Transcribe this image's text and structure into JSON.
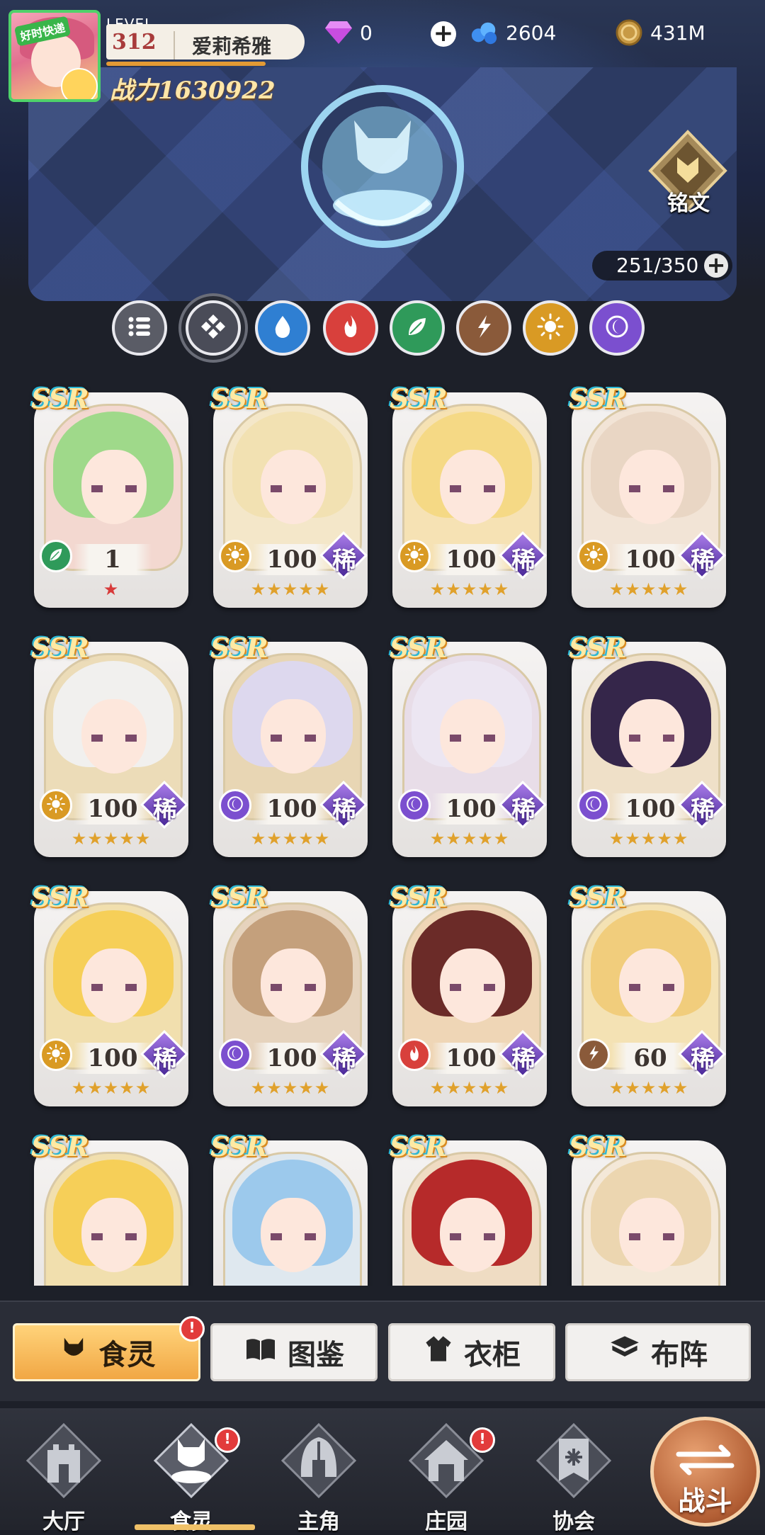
{
  "player": {
    "avatar_badge": "好时快递",
    "level_label": "LEVEL",
    "level": "312",
    "name": "爱莉希雅",
    "power": "战力1630922"
  },
  "resources": {
    "diamond": "0",
    "crystal": "2604",
    "coin": "431M"
  },
  "rune_label": "铭文",
  "capacity": "251/350",
  "filters": [
    {
      "name": "list",
      "color": "#5a5c66",
      "active": false
    },
    {
      "name": "all",
      "color": "#4a4c58",
      "active": true
    },
    {
      "name": "water",
      "color": "#2f7fd2",
      "active": false
    },
    {
      "name": "fire",
      "color": "#d8403c",
      "active": false
    },
    {
      "name": "leaf",
      "color": "#2f9a5a",
      "active": false
    },
    {
      "name": "earth",
      "color": "#8a5a3a",
      "active": false
    },
    {
      "name": "sun",
      "color": "#d99a24",
      "active": false
    },
    {
      "name": "moon",
      "color": "#7b4fcf",
      "active": false
    }
  ],
  "cards": [
    {
      "rarity": "SSR",
      "level": "1",
      "element": "leaf",
      "rare_tag": "",
      "stars": "★",
      "star_color": "red",
      "bg": "#f3d8d0",
      "hair": "#9fd98a"
    },
    {
      "rarity": "SSR",
      "level": "100",
      "element": "sun",
      "rare_tag": "稀",
      "stars": "★★★★★",
      "star_color": "gold",
      "bg": "#f4e7c9",
      "hair": "#f2e1b2"
    },
    {
      "rarity": "SSR",
      "level": "100",
      "element": "sun",
      "rare_tag": "稀",
      "stars": "★★★★★",
      "star_color": "gold",
      "bg": "#f6e2b4",
      "hair": "#f5d985"
    },
    {
      "rarity": "SSR",
      "level": "100",
      "element": "sun",
      "rare_tag": "稀",
      "stars": "★★★★★",
      "star_color": "gold",
      "bg": "#f2e4d6",
      "hair": "#e9d6c4"
    },
    {
      "rarity": "SSR",
      "level": "100",
      "element": "sun",
      "rare_tag": "稀",
      "stars": "★★★★★",
      "star_color": "gold",
      "bg": "#ecdcb8",
      "hair": "#f1f0ee"
    },
    {
      "rarity": "SSR",
      "level": "100",
      "element": "moon",
      "rare_tag": "稀",
      "stars": "★★★★★",
      "star_color": "gold",
      "bg": "#e8d6b4",
      "hair": "#ddd8ee"
    },
    {
      "rarity": "SSR",
      "level": "100",
      "element": "moon",
      "rare_tag": "稀",
      "stars": "★★★★★",
      "star_color": "gold",
      "bg": "#e8dde8",
      "hair": "#ece6f2"
    },
    {
      "rarity": "SSR",
      "level": "100",
      "element": "moon",
      "rare_tag": "稀",
      "stars": "★★★★★",
      "star_color": "gold",
      "bg": "#efe0c8",
      "hair": "#35264a"
    },
    {
      "rarity": "SSR",
      "level": "100",
      "element": "sun",
      "rare_tag": "稀",
      "stars": "★★★★★",
      "star_color": "gold",
      "bg": "#f1dfae",
      "hair": "#f6cf58"
    },
    {
      "rarity": "SSR",
      "level": "100",
      "element": "moon",
      "rare_tag": "稀",
      "stars": "★★★★★",
      "star_color": "gold",
      "bg": "#e6d3bd",
      "hair": "#c4a07c"
    },
    {
      "rarity": "SSR",
      "level": "100",
      "element": "fire",
      "rare_tag": "稀",
      "stars": "★★★★★",
      "star_color": "gold",
      "bg": "#efd6b6",
      "hair": "#6b2b28"
    },
    {
      "rarity": "SSR",
      "level": "60",
      "element": "earth",
      "rare_tag": "稀",
      "stars": "★★★★★",
      "star_color": "gold",
      "bg": "#f4e2b4",
      "hair": "#f1cd7c"
    },
    {
      "rarity": "SSR",
      "level": "",
      "element": "",
      "rare_tag": "",
      "stars": "",
      "star_color": "gold",
      "bg": "#f1dfae",
      "hair": "#f6cf58"
    },
    {
      "rarity": "SSR",
      "level": "",
      "element": "",
      "rare_tag": "",
      "stars": "",
      "star_color": "gold",
      "bg": "#dfe8ef",
      "hair": "#9cc9ec"
    },
    {
      "rarity": "SSR",
      "level": "",
      "element": "",
      "rare_tag": "",
      "stars": "",
      "star_color": "gold",
      "bg": "#efdcc3",
      "hair": "#b62a2a"
    },
    {
      "rarity": "SSR",
      "level": "",
      "element": "",
      "rare_tag": "",
      "stars": "",
      "star_color": "gold",
      "bg": "#f4e8d8",
      "hair": "#ecd6b0"
    }
  ],
  "subtabs": [
    {
      "label": "食灵",
      "active": true,
      "notify": "!"
    },
    {
      "label": "图鉴",
      "active": false,
      "notify": ""
    },
    {
      "label": "衣柜",
      "active": false,
      "notify": ""
    },
    {
      "label": "布阵",
      "active": false,
      "notify": ""
    }
  ],
  "nav": [
    {
      "label": "大厅",
      "icon": "castle-icon",
      "active": false,
      "notify": ""
    },
    {
      "label": "食灵",
      "icon": "food-spirit-icon",
      "active": true,
      "notify": "!"
    },
    {
      "label": "主角",
      "icon": "helmet-icon",
      "active": false,
      "notify": ""
    },
    {
      "label": "庄园",
      "icon": "manor-icon",
      "active": false,
      "notify": "!"
    },
    {
      "label": "协会",
      "icon": "guild-banner-icon",
      "active": false,
      "notify": ""
    }
  ],
  "battle_label": "战斗",
  "colors": {
    "accent": "#f1a744",
    "power": "#ffe6a8",
    "rare": "#6b3fc0",
    "star": "#e0a12c"
  }
}
